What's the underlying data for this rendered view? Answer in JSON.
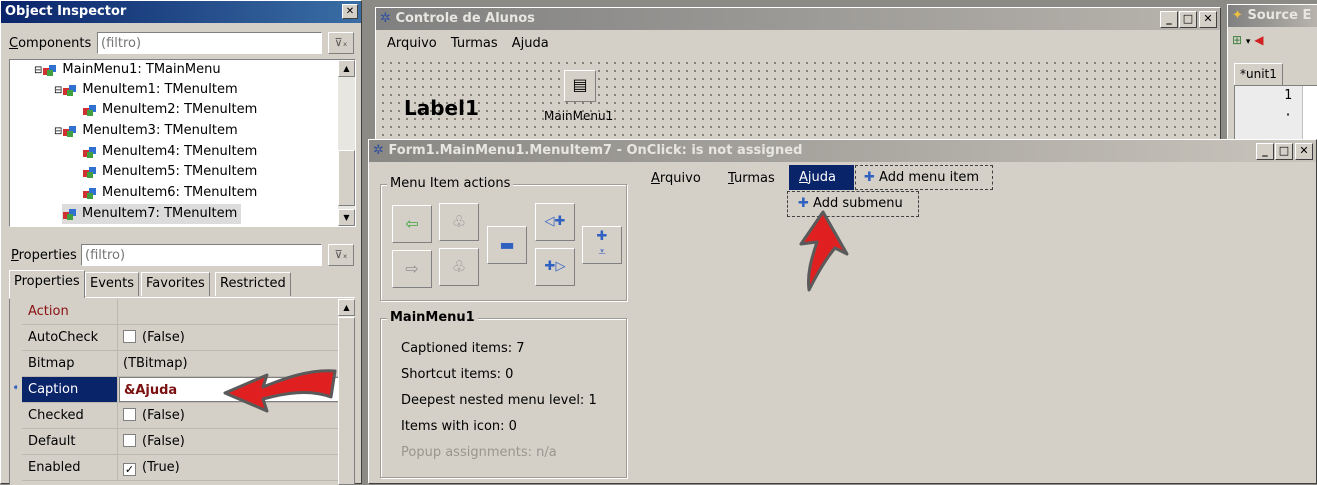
{
  "object_inspector": {
    "title": "Object Inspector",
    "close_glyph": "✕",
    "components_label": "Components",
    "components_filter_placeholder": "(filtro)",
    "tree": [
      {
        "label": "MainMenu1: TMainMenu"
      },
      {
        "label": "MenuItem1: TMenuItem"
      },
      {
        "label": "MenuItem2: TMenuItem"
      },
      {
        "label": "MenuItem3: TMenuItem"
      },
      {
        "label": "MenuItem4: TMenuItem"
      },
      {
        "label": "MenuItem5: TMenuItem"
      },
      {
        "label": "MenuItem6: TMenuItem"
      },
      {
        "label": "MenuItem7: TMenuItem"
      }
    ],
    "properties_label": "Properties",
    "properties_filter_placeholder": "(filtro)",
    "tabs": [
      "Properties",
      "Events",
      "Favorites",
      "Restricted"
    ],
    "props": [
      {
        "name": "Action",
        "value": ""
      },
      {
        "name": "AutoCheck",
        "value": "(False)"
      },
      {
        "name": "Bitmap",
        "value": "(TBitmap)"
      },
      {
        "name": "Caption",
        "value": "&Ajuda"
      },
      {
        "name": "Checked",
        "value": "(False)"
      },
      {
        "name": "Default",
        "value": "(False)"
      },
      {
        "name": "Enabled",
        "value": "(True)"
      }
    ]
  },
  "form_window": {
    "title": "Controle de Alunos",
    "menu": [
      "Arquivo",
      "Turmas",
      "Ajuda"
    ],
    "label": "Label1",
    "mainmenu_component": "MainMenu1",
    "btn_min": "_",
    "btn_max": "□",
    "btn_close": "✕"
  },
  "source_editor": {
    "title": "Source E",
    "tab": "*unit1",
    "gutter": [
      "1",
      "·"
    ]
  },
  "menu_editor": {
    "title": "Form1.MainMenu1.MenuItem7 - OnClick: is not assigned",
    "actions_group": "Menu Item actions",
    "menu_items": [
      {
        "label": "Arquivo",
        "underline": "A",
        "rest": "rquivo"
      },
      {
        "label": "Turmas",
        "underline": "T",
        "rest": "urmas"
      },
      {
        "label": "Ajuda",
        "underline": "A",
        "rest": "juda"
      }
    ],
    "add_menu_item": "Add menu item",
    "add_submenu": "Add submenu",
    "stats_group": "MainMenu1",
    "stats": [
      "Captioned items: 7",
      "Shortcut items: 0",
      "Deepest nested menu level: 1",
      "Items with icon: 0",
      "Popup assignments: n/a"
    ]
  },
  "colors": {
    "active_title": "#0a246a",
    "window_face": "#d4d0c8",
    "selection": "#0a246a",
    "caption_value": "#7a1010",
    "arrow": "#e02020"
  }
}
